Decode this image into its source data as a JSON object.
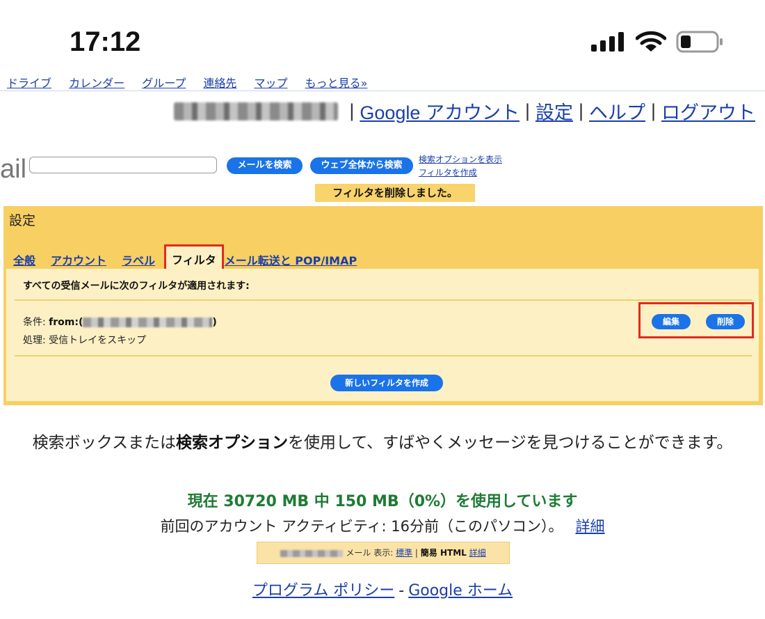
{
  "status_bar": {
    "time": "17:12",
    "signal_icon": "cellular-signal-icon",
    "wifi_icon": "wifi-icon",
    "battery_icon": "battery-low-icon"
  },
  "top_nav": {
    "items": [
      "ドライブ",
      "カレンダー",
      "グループ",
      "連絡先",
      "マップ"
    ],
    "more": "もっと見る»"
  },
  "account": {
    "google_account": "Google アカウント",
    "settings": "設定",
    "help": "ヘルプ",
    "logout": "ログアウト",
    "separator": "|"
  },
  "search": {
    "logo_fragment": "ail",
    "search_mail_button": "メールを検索",
    "search_web_button": "ウェブ全体から検索",
    "show_options_link": "検索オプションを表示",
    "create_filter_link": "フィルタを作成"
  },
  "notice": "フィルタを削除しました。",
  "settings": {
    "title": "設定",
    "tabs": [
      "全般",
      "アカウント",
      "ラベル",
      "フィルタ",
      "メール転送と POP/IMAP"
    ],
    "active_tab": "フィルタ",
    "heading": "すべての受信メールに次のフィルタが適用されます:",
    "filter": {
      "condition_label": "条件:",
      "condition_value_prefix": "from:(",
      "condition_value_suffix": ")",
      "action_label": "処理:",
      "action_value": "受信トレイをスキップ",
      "edit_button": "編集",
      "delete_button": "削除"
    },
    "new_filter_button": "新しいフィルタを作成"
  },
  "footer": {
    "tip_part1": "検索ボックスまたは",
    "tip_bold": "検索オプション",
    "tip_part2": "を使用して、すばやくメッセージを見つけることができます。",
    "usage": "現在 30720 MB 中 150 MB（0%）を使用しています",
    "activity": "前回のアカウント アクティビティ: 16分前（このパソコン）。",
    "details_link": "詳細",
    "view_label": "メール 表示:",
    "view_standard": "標準",
    "view_sep": "|",
    "view_basic_html": "簡易 HTML",
    "view_details": "詳細",
    "program_policy": "プログラム ポリシー",
    "dash": "-",
    "google_home": "Google ホーム"
  }
}
